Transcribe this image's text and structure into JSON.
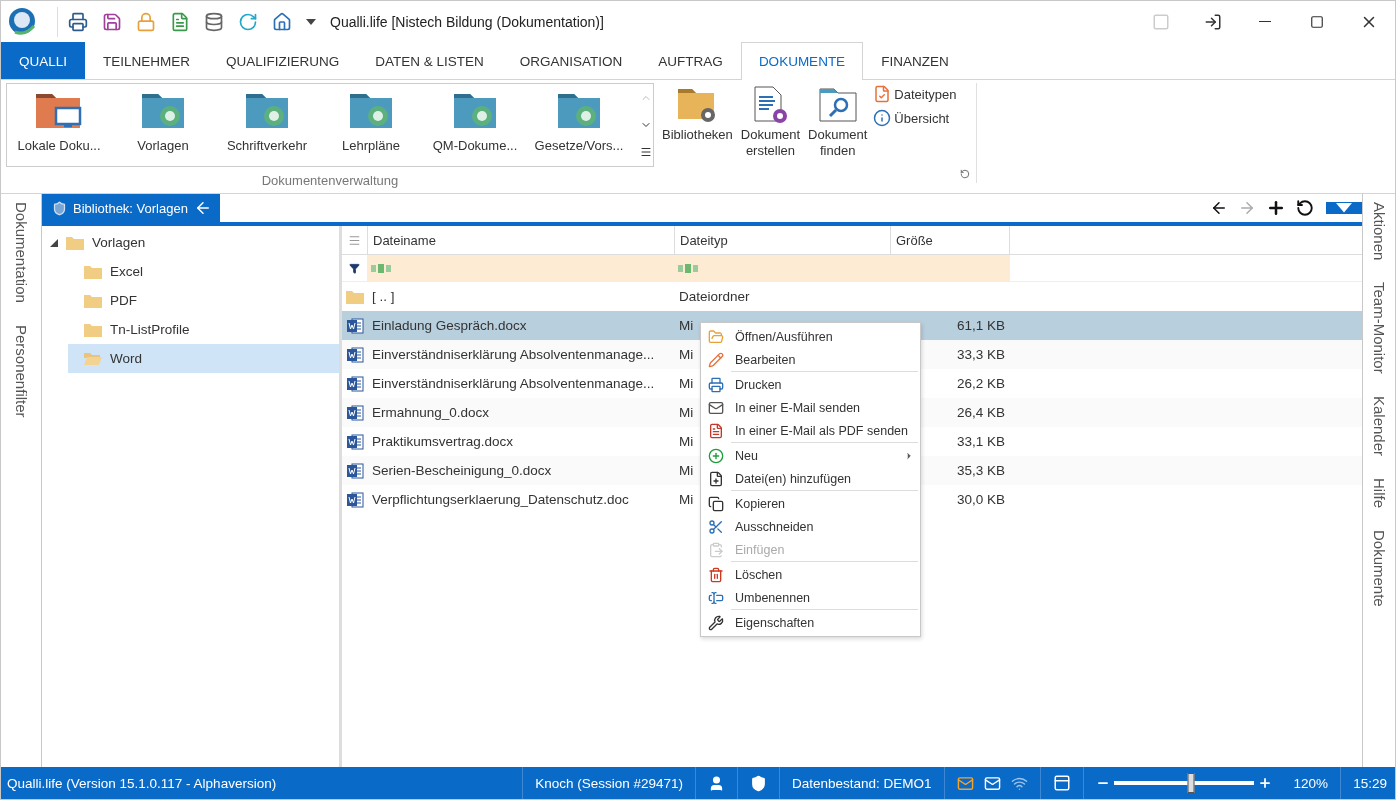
{
  "window": {
    "title": "Qualli.life [Nistech Bildung (Dokumentation)]"
  },
  "ribbon_tabs": [
    {
      "label": "QUALLI",
      "kind": "app",
      "selected": false
    },
    {
      "label": "TEILNEHMER",
      "kind": "tab",
      "selected": false
    },
    {
      "label": "QUALIFIZIERUNG",
      "kind": "tab",
      "selected": false
    },
    {
      "label": "DATEN & LISTEN",
      "kind": "tab",
      "selected": false
    },
    {
      "label": "ORGANISATION",
      "kind": "tab",
      "selected": false
    },
    {
      "label": "AUFTRAG",
      "kind": "tab",
      "selected": false
    },
    {
      "label": "DOKUMENTE",
      "kind": "tab",
      "selected": true
    },
    {
      "label": "FINANZEN",
      "kind": "tab",
      "selected": false
    }
  ],
  "ribbon": {
    "gallery": {
      "label": "Dokumentenverwaltung",
      "items": [
        {
          "label": "Lokale Doku...",
          "kind": "local"
        },
        {
          "label": "Vorlagen",
          "kind": "library"
        },
        {
          "label": "Schriftverkehr",
          "kind": "library"
        },
        {
          "label": "Lehrpläne",
          "kind": "library"
        },
        {
          "label": "QM-Dokume...",
          "kind": "library"
        },
        {
          "label": "Gesetze/Vors...",
          "kind": "library"
        }
      ]
    },
    "large_buttons": [
      {
        "label": "Bibliotheken"
      },
      {
        "label": "Dokument erstellen"
      },
      {
        "label": "Dokument finden"
      }
    ],
    "small_buttons": [
      {
        "label": "Dateitypen"
      },
      {
        "label": "Übersicht"
      }
    ]
  },
  "left_sidebar": [
    "Dokumentation",
    "Personenfilter"
  ],
  "right_sidebar": [
    "Aktionen",
    "Team-Monitor",
    "Kalender",
    "Hilfe",
    "Dokumente"
  ],
  "document_tab": {
    "label": "Bibliothek: Vorlagen"
  },
  "toolbar": {
    "back_disabled": false,
    "forward_disabled": true
  },
  "tree": [
    {
      "label": "Vorlagen",
      "expanded": true,
      "selected": false,
      "children": [
        {
          "label": "Excel",
          "selected": false
        },
        {
          "label": "PDF",
          "selected": false
        },
        {
          "label": "Tn-ListProfile",
          "selected": false
        },
        {
          "label": "Word",
          "selected": true
        }
      ]
    }
  ],
  "table": {
    "columns": [
      "Dateiname",
      "Dateityp",
      "Größe"
    ],
    "rows": [
      {
        "kind": "folder",
        "name": "[ .. ]",
        "type": "Dateiordner",
        "selected": false
      },
      {
        "kind": "word",
        "name": "Einladung Gespräch.docx",
        "type": "Mi",
        "size": "61,1 KB",
        "selected": true
      },
      {
        "kind": "word",
        "name": "Einverständniserklärung Absolventenmanage...",
        "type": "Mi",
        "size": "33,3 KB",
        "selected": false
      },
      {
        "kind": "word",
        "name": "Einverständniserklärung Absolventenmanage...",
        "type": "Mi",
        "size": "26,2 KB",
        "selected": false
      },
      {
        "kind": "word",
        "name": "Ermahnung_0.docx",
        "type": "Mi",
        "size": "26,4 KB",
        "selected": false
      },
      {
        "kind": "word",
        "name": "Praktikumsvertrag.docx",
        "type": "Mi",
        "size": "33,1 KB",
        "selected": false
      },
      {
        "kind": "word",
        "name": "Serien-Bescheinigung_0.docx",
        "type": "Mi",
        "size": "35,3 KB",
        "selected": false
      },
      {
        "kind": "word",
        "name": "Verpflichtungserklaerung_Datenschutz.doc",
        "type": "Mi",
        "size": "30,0 KB",
        "selected": false
      }
    ]
  },
  "context_menu": [
    {
      "label": "Öffnen/Ausführen",
      "separator_before": false,
      "disabled": false,
      "submenu": false
    },
    {
      "label": "Bearbeiten",
      "separator_before": false,
      "disabled": false,
      "submenu": false
    },
    {
      "label": "Drucken",
      "separator_before": true,
      "disabled": false,
      "submenu": false
    },
    {
      "label": "In einer E-Mail senden",
      "separator_before": false,
      "disabled": false,
      "submenu": false
    },
    {
      "label": "In einer E-Mail als PDF senden",
      "separator_before": false,
      "disabled": false,
      "submenu": false
    },
    {
      "label": "Neu",
      "separator_before": true,
      "disabled": false,
      "submenu": true
    },
    {
      "label": "Datei(en) hinzufügen",
      "separator_before": false,
      "disabled": false,
      "submenu": false
    },
    {
      "label": "Kopieren",
      "separator_before": true,
      "disabled": false,
      "submenu": false
    },
    {
      "label": "Ausschneiden",
      "separator_before": false,
      "disabled": false,
      "submenu": false
    },
    {
      "label": "Einfügen",
      "separator_before": false,
      "disabled": true,
      "submenu": false
    },
    {
      "label": "Löschen",
      "separator_before": true,
      "disabled": false,
      "submenu": false
    },
    {
      "label": "Umbenennen",
      "separator_before": false,
      "disabled": false,
      "submenu": false
    },
    {
      "label": "Eigenschaften",
      "separator_before": true,
      "disabled": false,
      "submenu": false
    }
  ],
  "status_bar": {
    "app_version": "Qualli.life (Version 15.1.0.117 - Alphaversion)",
    "session": "Knoch (Session #29471)",
    "database": "Datenbestand: DEMO1",
    "zoom": {
      "level": 0.55,
      "reading": "120%"
    },
    "time": "15:29"
  }
}
